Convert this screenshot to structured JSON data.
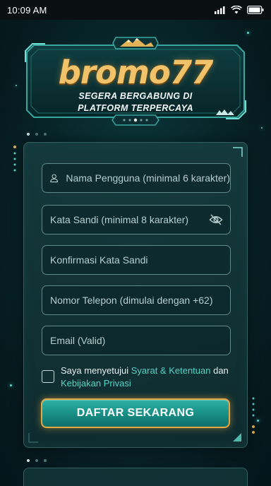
{
  "status_bar": {
    "time": "10:09 AM"
  },
  "brand": {
    "logo_text": "bromo77",
    "tagline_line1": "SEGERA BERGABUNG DI",
    "tagline_line2": "PLATFORM TERPERCAYA"
  },
  "form": {
    "username_placeholder": "Nama Pengguna (minimal 6 karakter)",
    "password_placeholder": "Kata Sandi (minimal 8 karakter)",
    "confirm_password_placeholder": "Konfirmasi Kata Sandi",
    "phone_placeholder": "Nomor Telepon (dimulai dengan +62)",
    "email_placeholder": "Email (Valid)",
    "agree_prefix": "Saya menyetujui ",
    "terms_link": "Syarat & Ketentuan",
    "agree_mid": " dan",
    "privacy_link": "Kebijakan Privasi",
    "submit_label": "DAFTAR SEKARANG"
  },
  "colors": {
    "accent_teal": "#56d4c6",
    "gold": "#e3a744",
    "background": "#082a2e"
  },
  "icons": [
    "user-icon",
    "eye-off-icon",
    "checkbox",
    "mountain-icon",
    "signal-icon",
    "wifi-icon",
    "battery-icon"
  ]
}
